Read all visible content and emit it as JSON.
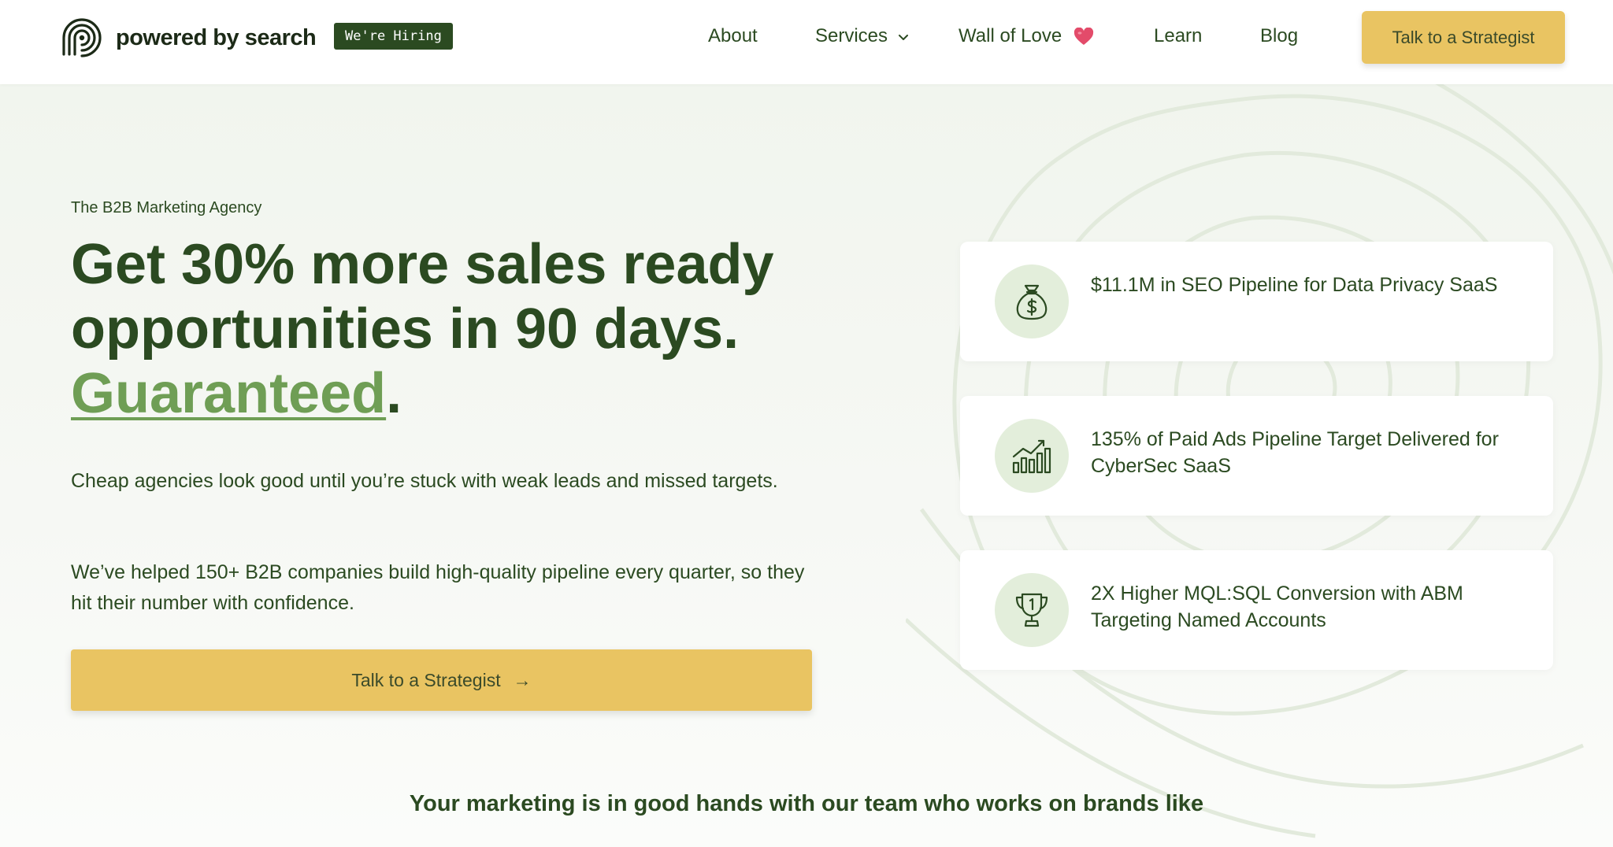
{
  "header": {
    "logo_text": "powered by search",
    "hiring_badge": "We're Hiring",
    "nav": {
      "about": "About",
      "services": "Services",
      "wall_of_love": "Wall of Love",
      "learn": "Learn",
      "blog": "Blog"
    },
    "cta_label": "Talk to a Strategist"
  },
  "hero": {
    "eyebrow": "The B2B Marketing Agency",
    "headline_line1": "Get 30% more sales ready",
    "headline_line2": "opportunities in 90 days.",
    "headline_accent": "Guaranteed",
    "headline_period": ".",
    "paragraph1": "Cheap agencies look good until you’re stuck with weak leads and missed targets.",
    "paragraph2": "We’ve helped 150+ B2B companies build high-quality pipeline every quarter, so they hit their number with confidence.",
    "cta_label": "Talk to a Strategist",
    "cta_arrow": "→"
  },
  "stats": [
    {
      "icon": "money-bag-icon",
      "text": "$11.1M in SEO Pipeline for Data Privacy SaaS"
    },
    {
      "icon": "growth-chart-icon",
      "text": "135% of Paid Ads Pipeline Target Delivered for CyberSec SaaS"
    },
    {
      "icon": "trophy-icon",
      "text": "2X Higher MQL:SQL Conversion with ABM Targeting Named Accounts"
    }
  ],
  "brands_heading": "Your marketing is in good hands with our team who works on brands like",
  "colors": {
    "brand_green": "#2b4a21",
    "accent_green": "#6f9e55",
    "cta_yellow": "#e9c462",
    "icon_bg": "#e3eedb",
    "heart": "#e34b6a"
  }
}
